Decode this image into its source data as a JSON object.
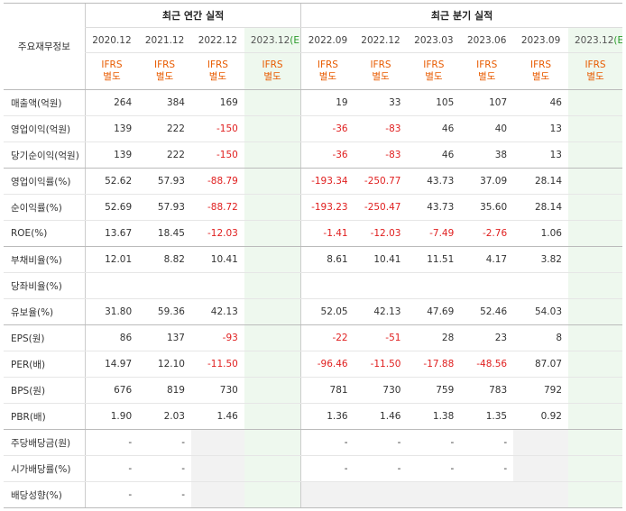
{
  "header": {
    "row_label": "주요재무정보",
    "annual_title": "최근 연간 실적",
    "quarter_title": "최근 분기 실적",
    "annual_periods": [
      "2020.12",
      "2021.12",
      "2022.12",
      "2023.12"
    ],
    "quarter_periods": [
      "2022.09",
      "2022.12",
      "2023.03",
      "2023.06",
      "2023.09",
      "2023.12"
    ],
    "estimate_mark": "(E)",
    "ifrs_top": "IFRS",
    "ifrs_bottom": "별도"
  },
  "rows": [
    {
      "label": "매출액(억원)",
      "annual": [
        "264",
        "384",
        "169",
        ""
      ],
      "quarter": [
        "19",
        "33",
        "105",
        "107",
        "46",
        ""
      ]
    },
    {
      "label": "영업이익(억원)",
      "annual": [
        "139",
        "222",
        "-150",
        ""
      ],
      "quarter": [
        "-36",
        "-83",
        "46",
        "40",
        "13",
        ""
      ]
    },
    {
      "label": "당기순이익(억원)",
      "annual": [
        "139",
        "222",
        "-150",
        ""
      ],
      "quarter": [
        "-36",
        "-83",
        "46",
        "38",
        "13",
        ""
      ]
    },
    {
      "label": "영업이익률(%)",
      "annual": [
        "52.62",
        "57.93",
        "-88.79",
        ""
      ],
      "quarter": [
        "-193.34",
        "-250.77",
        "43.73",
        "37.09",
        "28.14",
        ""
      ]
    },
    {
      "label": "순이익률(%)",
      "annual": [
        "52.69",
        "57.93",
        "-88.72",
        ""
      ],
      "quarter": [
        "-193.23",
        "-250.47",
        "43.73",
        "35.60",
        "28.14",
        ""
      ]
    },
    {
      "label": "ROE(%)",
      "annual": [
        "13.67",
        "18.45",
        "-12.03",
        ""
      ],
      "quarter": [
        "-1.41",
        "-12.03",
        "-7.49",
        "-2.76",
        "1.06",
        ""
      ]
    },
    {
      "label": "부채비율(%)",
      "annual": [
        "12.01",
        "8.82",
        "10.41",
        ""
      ],
      "quarter": [
        "8.61",
        "10.41",
        "11.51",
        "4.17",
        "3.82",
        ""
      ]
    },
    {
      "label": "당좌비율(%)",
      "annual": [
        "",
        "",
        "",
        ""
      ],
      "quarter": [
        "",
        "",
        "",
        "",
        "",
        ""
      ]
    },
    {
      "label": "유보율(%)",
      "annual": [
        "31.80",
        "59.36",
        "42.13",
        ""
      ],
      "quarter": [
        "52.05",
        "42.13",
        "47.69",
        "52.46",
        "54.03",
        ""
      ]
    },
    {
      "label": "EPS(원)",
      "annual": [
        "86",
        "137",
        "-93",
        ""
      ],
      "quarter": [
        "-22",
        "-51",
        "28",
        "23",
        "8",
        ""
      ]
    },
    {
      "label": "PER(배)",
      "annual": [
        "14.97",
        "12.10",
        "-11.50",
        ""
      ],
      "quarter": [
        "-96.46",
        "-11.50",
        "-17.88",
        "-48.56",
        "87.07",
        ""
      ]
    },
    {
      "label": "BPS(원)",
      "annual": [
        "676",
        "819",
        "730",
        ""
      ],
      "quarter": [
        "781",
        "730",
        "759",
        "783",
        "792",
        ""
      ]
    },
    {
      "label": "PBR(배)",
      "annual": [
        "1.90",
        "2.03",
        "1.46",
        ""
      ],
      "quarter": [
        "1.36",
        "1.46",
        "1.38",
        "1.35",
        "0.92",
        ""
      ]
    },
    {
      "label": "주당배당금(원)",
      "annual": [
        "-",
        "-",
        "",
        ""
      ],
      "quarter": [
        "-",
        "-",
        "-",
        "-",
        "",
        ""
      ]
    },
    {
      "label": "시가배당률(%)",
      "annual": [
        "-",
        "-",
        "",
        ""
      ],
      "quarter": [
        "-",
        "-",
        "-",
        "-",
        "",
        ""
      ]
    },
    {
      "label": "배당성향(%)",
      "annual": [
        "-",
        "-",
        "",
        ""
      ],
      "quarter": [
        "",
        "",
        "",
        "",
        "",
        ""
      ]
    }
  ],
  "colors": {
    "negative": "#e02020",
    "ifrs": "#e85b00",
    "estimate_bg": "#eef8ee",
    "estimate_mark": "#2a9a2a"
  }
}
